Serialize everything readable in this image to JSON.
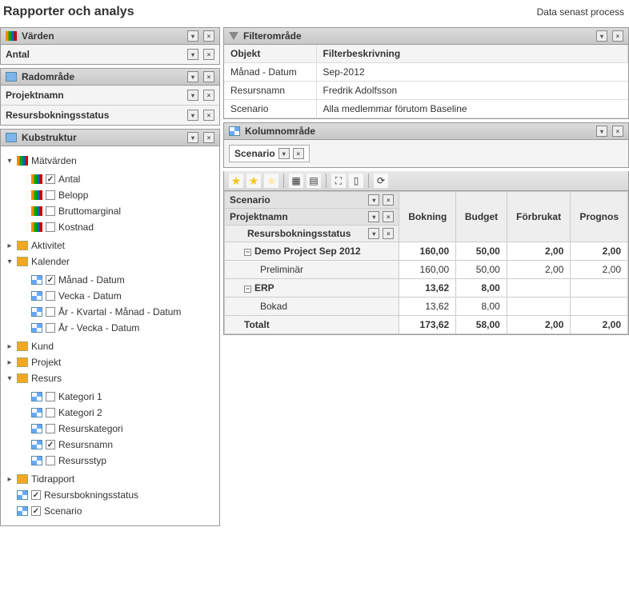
{
  "header": {
    "title": "Rapporter och analys",
    "status": "Data senast process"
  },
  "left": {
    "varden": {
      "title": "Värden",
      "items": [
        "Antal"
      ]
    },
    "radomrade": {
      "title": "Radområde",
      "items": [
        "Projektnamn",
        "Resursbokningsstatus"
      ]
    },
    "kub": {
      "title": "Kubstruktur",
      "matvarden": {
        "label": "Mätvärden",
        "items": [
          {
            "label": "Antal",
            "checked": true
          },
          {
            "label": "Belopp",
            "checked": false
          },
          {
            "label": "Bruttomarginal",
            "checked": false
          },
          {
            "label": "Kostnad",
            "checked": false
          }
        ]
      },
      "dims": {
        "aktivitet": "Aktivitet",
        "kalender": {
          "label": "Kalender",
          "items": [
            {
              "label": "Månad - Datum",
              "checked": true
            },
            {
              "label": "Vecka - Datum",
              "checked": false
            },
            {
              "label": "År - Kvartal - Månad - Datum",
              "checked": false
            },
            {
              "label": "År - Vecka - Datum",
              "checked": false
            }
          ]
        },
        "kund": "Kund",
        "projekt": "Projekt",
        "resurs": {
          "label": "Resurs",
          "items": [
            {
              "label": "Kategori 1",
              "checked": false
            },
            {
              "label": "Kategori 2",
              "checked": false
            },
            {
              "label": "Resurskategori",
              "checked": false
            },
            {
              "label": "Resursnamn",
              "checked": true
            },
            {
              "label": "Resursstyp",
              "checked": false
            }
          ]
        },
        "tidrapport": "Tidrapport"
      },
      "bottom": [
        {
          "label": "Resursbokningsstatus",
          "checked": true
        },
        {
          "label": "Scenario",
          "checked": true
        }
      ]
    }
  },
  "filter": {
    "title": "Filterområde",
    "head": {
      "obj": "Objekt",
      "desc": "Filterbeskrivning"
    },
    "rows": [
      {
        "k": "Månad - Datum",
        "v": "Sep-2012"
      },
      {
        "k": "Resursnamn",
        "v": "Fredrik Adolfsson"
      },
      {
        "k": "Scenario",
        "v": "Alla medlemmar förutom Baseline"
      }
    ]
  },
  "columns": {
    "title": "Kolumnområde",
    "chip": "Scenario"
  },
  "grid": {
    "row_headers": {
      "scenario": "Scenario",
      "projekt": "Projektnamn",
      "status": "Resursbokningsstatus"
    },
    "cols": [
      "Bokning",
      "Budget",
      "Förbrukat",
      "Prognos"
    ],
    "rows": [
      {
        "label": "Demo Project Sep 2012",
        "level": 0,
        "bold": true,
        "exp": true,
        "vals": [
          "160,00",
          "50,00",
          "2,00",
          "2,00"
        ]
      },
      {
        "label": "Preliminär",
        "level": 1,
        "vals": [
          "160,00",
          "50,00",
          "2,00",
          "2,00"
        ]
      },
      {
        "label": "ERP",
        "level": 0,
        "bold": true,
        "exp": true,
        "vals": [
          "13,62",
          "8,00",
          "",
          ""
        ]
      },
      {
        "label": "Bokad",
        "level": 1,
        "vals": [
          "13,62",
          "8,00",
          "",
          ""
        ]
      },
      {
        "label": "Totalt",
        "level": 0,
        "bold": true,
        "vals": [
          "173,62",
          "58,00",
          "2,00",
          "2,00"
        ]
      }
    ]
  }
}
